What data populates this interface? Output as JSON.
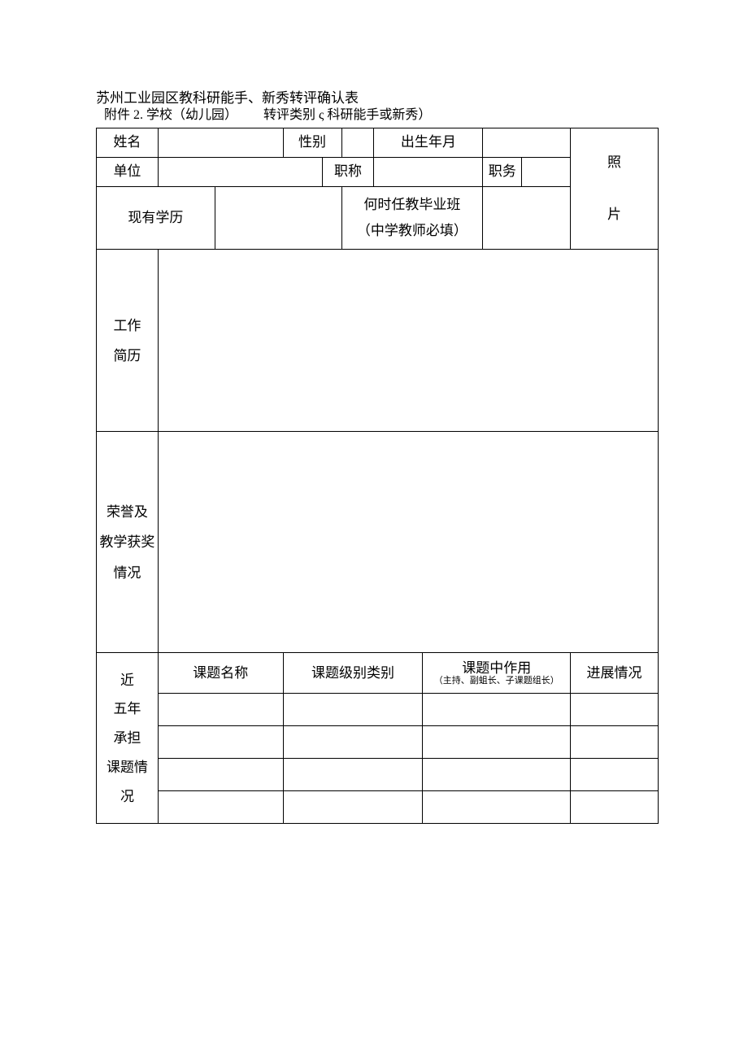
{
  "title": "苏州工业园区教科研能手、新秀转评确认表",
  "subtitle": "附件 2. 学校（幼儿园）  转评类别 ς 科研能手或新秀）",
  "labels": {
    "name": "姓名",
    "gender": "性别",
    "birth": "出生年月",
    "photo_top": "照",
    "photo_bottom": "片",
    "unit": "单位",
    "title_rank": "职称",
    "post": "职务",
    "education": "现有学历",
    "grad_class_line1": "何时任教毕业班",
    "grad_class_line2": "（中学教师必填）",
    "work_history_l1": "工作",
    "work_history_l2": "简历",
    "honors_l1": "荣誉及",
    "honors_l2": "教学获奖",
    "honors_l3": "情况",
    "recent5_l1": "近",
    "recent5_l2": "五年",
    "recent5_l3": "承担",
    "recent5_l4": "课题情",
    "recent5_l5": "况",
    "kt_name": "课题名称",
    "kt_level": "课题级别类别",
    "kt_role": "课题中作用",
    "kt_role_sub": "（主持、副蛆长、子课题组长）",
    "kt_progress": "进展情况"
  },
  "values": {
    "name": "",
    "gender": "",
    "birth": "",
    "unit": "",
    "title_rank": "",
    "post": "",
    "education": "",
    "grad_class": "",
    "work_history": "",
    "honors": ""
  }
}
